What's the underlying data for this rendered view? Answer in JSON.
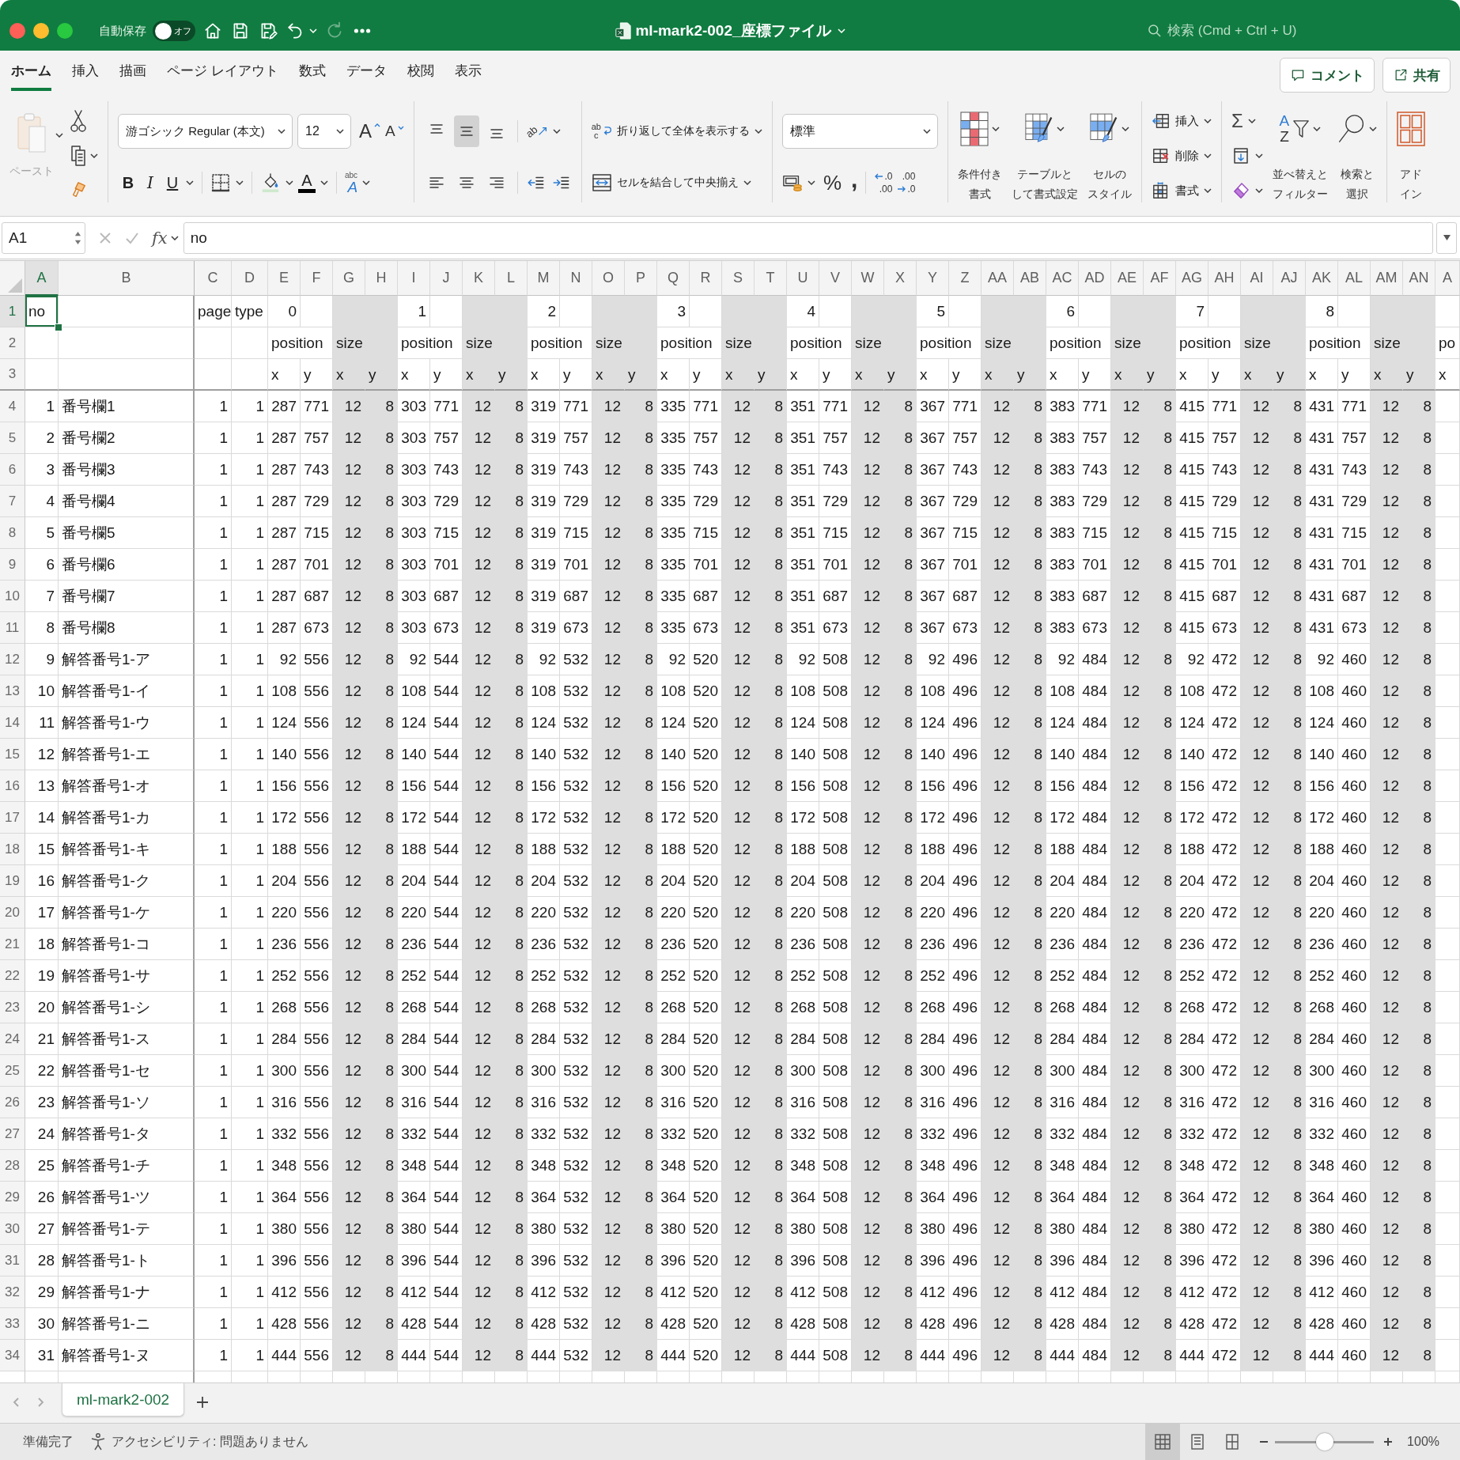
{
  "window": {
    "autosave": {
      "label": "自動保存",
      "on": false,
      "state": "オフ"
    },
    "redo": {
      "disabled": true
    },
    "title": "ml-mark2-002_座標ファイル",
    "search": {
      "placeholder": "検索 (Cmd + Ctrl + U)"
    }
  },
  "menu_tabs": [
    {
      "label": "ホーム",
      "selected": true
    },
    {
      "label": "挿入",
      "selected": false
    },
    {
      "label": "描画",
      "selected": false
    },
    {
      "label": "ページ レイアウト",
      "selected": false
    },
    {
      "label": "数式",
      "selected": false
    },
    {
      "label": "データ",
      "selected": false
    },
    {
      "label": "校閲",
      "selected": false
    },
    {
      "label": "表示",
      "selected": false
    }
  ],
  "header_buttons": [
    {
      "kind": "comment",
      "label": "コメント"
    },
    {
      "kind": "share",
      "label": "共有"
    }
  ],
  "ribbon": {
    "paste": {
      "label": "ペースト",
      "disabled": true
    },
    "font": {
      "name": "游ゴシック Regular (本文)",
      "size": "12",
      "grow": "A",
      "shrink": "A",
      "bold": "B",
      "italic": "I",
      "underline": "U",
      "color_letter": "A",
      "phonetic": [
        "abc",
        "A"
      ]
    },
    "alignment": {
      "vertical": [
        {
          "kind": "top",
          "selected": false
        },
        {
          "kind": "middle",
          "selected": true
        },
        {
          "kind": "bottom",
          "selected": false
        }
      ],
      "orientation": "ab",
      "horizontal": [
        {
          "kind": "left",
          "selected": false
        },
        {
          "kind": "center",
          "selected": false
        },
        {
          "kind": "right",
          "selected": false
        }
      ]
    },
    "wrap": {
      "icon_text": [
        "ab",
        "c"
      ],
      "label": "折り返して全体を表示する"
    },
    "merge": {
      "label": "セルを結合して中央揃え"
    },
    "number": {
      "format": "標準",
      "percent": "%",
      "comma": ",",
      "decimals": [
        {
          "kind": "increase",
          "top": ".0",
          "bottom": ".00"
        },
        {
          "kind": "decrease",
          "top": ".00",
          "bottom": ".0"
        }
      ]
    },
    "styles": [
      {
        "kind": "conditional",
        "lines": [
          "条件付き",
          "書式"
        ]
      },
      {
        "kind": "table",
        "lines": [
          "テーブルと",
          "して書式設定"
        ]
      },
      {
        "kind": "cell",
        "lines": [
          "セルの",
          "スタイル"
        ]
      }
    ],
    "cells": [
      {
        "kind": "insert",
        "label": "挿入"
      },
      {
        "kind": "delete",
        "label": "削除"
      },
      {
        "kind": "format",
        "label": "書式"
      }
    ],
    "editing": {
      "sum": "Σ",
      "sort": {
        "letters": [
          "A",
          "Z"
        ],
        "lines": [
          "並べ替えと",
          "フィルター"
        ]
      },
      "find": {
        "lines": [
          "検索と",
          "選択"
        ]
      }
    },
    "addins": {
      "lines": [
        "アド",
        "イン"
      ]
    }
  },
  "formula_bar": {
    "name_box": "A1",
    "cancel": {
      "disabled": true
    },
    "enter": {
      "disabled": true
    },
    "function_label": "fx",
    "formula": "no"
  },
  "sheet": {
    "frozen_columns": [
      {
        "label": "A",
        "selected": true,
        "shaded": false,
        "numeric": true
      },
      {
        "label": "B",
        "selected": false,
        "shaded": false,
        "numeric": false
      }
    ],
    "columns": [
      {
        "label": "C",
        "selected": false,
        "shaded": false,
        "numeric": true
      },
      {
        "label": "D",
        "selected": false,
        "shaded": false,
        "numeric": true
      },
      {
        "label": "E",
        "selected": false,
        "shaded": false,
        "numeric": true
      },
      {
        "label": "F",
        "selected": false,
        "shaded": false,
        "numeric": true
      },
      {
        "label": "G",
        "selected": false,
        "shaded": true,
        "numeric": true
      },
      {
        "label": "H",
        "selected": false,
        "shaded": true,
        "numeric": true
      },
      {
        "label": "I",
        "selected": false,
        "shaded": false,
        "numeric": true
      },
      {
        "label": "J",
        "selected": false,
        "shaded": false,
        "numeric": true
      },
      {
        "label": "K",
        "selected": false,
        "shaded": true,
        "numeric": true
      },
      {
        "label": "L",
        "selected": false,
        "shaded": true,
        "numeric": true
      },
      {
        "label": "M",
        "selected": false,
        "shaded": false,
        "numeric": true
      },
      {
        "label": "N",
        "selected": false,
        "shaded": false,
        "numeric": true
      },
      {
        "label": "O",
        "selected": false,
        "shaded": true,
        "numeric": true
      },
      {
        "label": "P",
        "selected": false,
        "shaded": true,
        "numeric": true
      },
      {
        "label": "Q",
        "selected": false,
        "shaded": false,
        "numeric": true
      },
      {
        "label": "R",
        "selected": false,
        "shaded": false,
        "numeric": true
      },
      {
        "label": "S",
        "selected": false,
        "shaded": true,
        "numeric": true
      },
      {
        "label": "T",
        "selected": false,
        "shaded": true,
        "numeric": true
      },
      {
        "label": "U",
        "selected": false,
        "shaded": false,
        "numeric": true
      },
      {
        "label": "V",
        "selected": false,
        "shaded": false,
        "numeric": true
      },
      {
        "label": "W",
        "selected": false,
        "shaded": true,
        "numeric": true
      },
      {
        "label": "X",
        "selected": false,
        "shaded": true,
        "numeric": true
      },
      {
        "label": "Y",
        "selected": false,
        "shaded": false,
        "numeric": true
      },
      {
        "label": "Z",
        "selected": false,
        "shaded": false,
        "numeric": true
      },
      {
        "label": "AA",
        "selected": false,
        "shaded": true,
        "numeric": true
      },
      {
        "label": "AB",
        "selected": false,
        "shaded": true,
        "numeric": true
      },
      {
        "label": "AC",
        "selected": false,
        "shaded": false,
        "numeric": true
      },
      {
        "label": "AD",
        "selected": false,
        "shaded": false,
        "numeric": true
      },
      {
        "label": "AE",
        "selected": false,
        "shaded": true,
        "numeric": true
      },
      {
        "label": "AF",
        "selected": false,
        "shaded": true,
        "numeric": true
      },
      {
        "label": "AG",
        "selected": false,
        "shaded": false,
        "numeric": true
      },
      {
        "label": "AH",
        "selected": false,
        "shaded": false,
        "numeric": true
      },
      {
        "label": "AI",
        "selected": false,
        "shaded": true,
        "numeric": true
      },
      {
        "label": "AJ",
        "selected": false,
        "shaded": true,
        "numeric": true
      },
      {
        "label": "AK",
        "selected": false,
        "shaded": false,
        "numeric": true
      },
      {
        "label": "AL",
        "selected": false,
        "shaded": false,
        "numeric": true
      },
      {
        "label": "AM",
        "selected": false,
        "shaded": true,
        "numeric": true
      },
      {
        "label": "AN",
        "selected": false,
        "shaded": true,
        "numeric": true
      },
      {
        "label": "A",
        "selected": false,
        "shaded": false
      }
    ],
    "header_rows": [
      {
        "header": "1",
        "selected": true,
        "cells": [
          {
            "text": "no",
            "numeric": false
          },
          null,
          {
            "text": "page",
            "numeric": false
          },
          {
            "text": "type",
            "numeric": false
          },
          {
            "text": "0",
            "numeric": true
          },
          null,
          null,
          null,
          {
            "text": "1",
            "numeric": true
          },
          null,
          null,
          null,
          {
            "text": "2",
            "numeric": true
          },
          null,
          null,
          null,
          {
            "text": "3",
            "numeric": true
          },
          null,
          null,
          null,
          {
            "text": "4",
            "numeric": true
          },
          null,
          null,
          null,
          {
            "text": "5",
            "numeric": true
          },
          null,
          null,
          null,
          {
            "text": "6",
            "numeric": true
          },
          null,
          null,
          null,
          {
            "text": "7",
            "numeric": true
          },
          null,
          null,
          null,
          {
            "text": "8",
            "numeric": true
          }
        ]
      },
      {
        "header": "2",
        "selected": false,
        "cells": [
          null,
          null,
          null,
          null,
          {
            "text": "position",
            "numeric": false
          },
          null,
          {
            "text": "size",
            "numeric": false
          },
          null,
          {
            "text": "position",
            "numeric": false
          },
          null,
          {
            "text": "size",
            "numeric": false
          },
          null,
          {
            "text": "position",
            "numeric": false
          },
          null,
          {
            "text": "size",
            "numeric": false
          },
          null,
          {
            "text": "position",
            "numeric": false
          },
          null,
          {
            "text": "size",
            "numeric": false
          },
          null,
          {
            "text": "position",
            "numeric": false
          },
          null,
          {
            "text": "size",
            "numeric": false
          },
          null,
          {
            "text": "position",
            "numeric": false
          },
          null,
          {
            "text": "size",
            "numeric": false
          },
          null,
          {
            "text": "position",
            "numeric": false
          },
          null,
          {
            "text": "size",
            "numeric": false
          },
          null,
          {
            "text": "position",
            "numeric": false
          },
          null,
          {
            "text": "size",
            "numeric": false
          },
          null,
          {
            "text": "position",
            "numeric": false
          },
          null,
          {
            "text": "size",
            "numeric": false
          },
          null,
          {
            "text": "po",
            "numeric": false
          }
        ]
      },
      {
        "header": "3",
        "selected": false,
        "cells": [
          null,
          null,
          null,
          null,
          {
            "text": "x",
            "numeric": false
          },
          {
            "text": "y",
            "numeric": false
          },
          {
            "text": "x",
            "numeric": false
          },
          {
            "text": "y",
            "numeric": false
          },
          {
            "text": "x",
            "numeric": false
          },
          {
            "text": "y",
            "numeric": false
          },
          {
            "text": "x",
            "numeric": false
          },
          {
            "text": "y",
            "numeric": false
          },
          {
            "text": "x",
            "numeric": false
          },
          {
            "text": "y",
            "numeric": false
          },
          {
            "text": "x",
            "numeric": false
          },
          {
            "text": "y",
            "numeric": false
          },
          {
            "text": "x",
            "numeric": false
          },
          {
            "text": "y",
            "numeric": false
          },
          {
            "text": "x",
            "numeric": false
          },
          {
            "text": "y",
            "numeric": false
          },
          {
            "text": "x",
            "numeric": false
          },
          {
            "text": "y",
            "numeric": false
          },
          {
            "text": "x",
            "numeric": false
          },
          {
            "text": "y",
            "numeric": false
          },
          {
            "text": "x",
            "numeric": false
          },
          {
            "text": "y",
            "numeric": false
          },
          {
            "text": "x",
            "numeric": false
          },
          {
            "text": "y",
            "numeric": false
          },
          {
            "text": "x",
            "numeric": false
          },
          {
            "text": "y",
            "numeric": false
          },
          {
            "text": "x",
            "numeric": false
          },
          {
            "text": "y",
            "numeric": false
          },
          {
            "text": "x",
            "numeric": false
          },
          {
            "text": "y",
            "numeric": false
          },
          {
            "text": "x",
            "numeric": false
          },
          {
            "text": "y",
            "numeric": false
          },
          {
            "text": "x",
            "numeric": false
          },
          {
            "text": "y",
            "numeric": false
          },
          {
            "text": "x",
            "numeric": false
          },
          {
            "text": "y",
            "numeric": false
          },
          {
            "text": "x",
            "numeric": false
          }
        ]
      }
    ],
    "data_rows": [
      {
        "header": "4",
        "selected": false,
        "cells": [
          "1",
          "番号欄1",
          "1",
          "1",
          "287",
          "771",
          "12",
          "8",
          "303",
          "771",
          "12",
          "8",
          "319",
          "771",
          "12",
          "8",
          "335",
          "771",
          "12",
          "8",
          "351",
          "771",
          "12",
          "8",
          "367",
          "771",
          "12",
          "8",
          "383",
          "771",
          "12",
          "8",
          "415",
          "771",
          "12",
          "8",
          "431",
          "771",
          "12",
          "8"
        ]
      },
      {
        "header": "5",
        "selected": false,
        "cells": [
          "2",
          "番号欄2",
          "1",
          "1",
          "287",
          "757",
          "12",
          "8",
          "303",
          "757",
          "12",
          "8",
          "319",
          "757",
          "12",
          "8",
          "335",
          "757",
          "12",
          "8",
          "351",
          "757",
          "12",
          "8",
          "367",
          "757",
          "12",
          "8",
          "383",
          "757",
          "12",
          "8",
          "415",
          "757",
          "12",
          "8",
          "431",
          "757",
          "12",
          "8"
        ]
      },
      {
        "header": "6",
        "selected": false,
        "cells": [
          "3",
          "番号欄3",
          "1",
          "1",
          "287",
          "743",
          "12",
          "8",
          "303",
          "743",
          "12",
          "8",
          "319",
          "743",
          "12",
          "8",
          "335",
          "743",
          "12",
          "8",
          "351",
          "743",
          "12",
          "8",
          "367",
          "743",
          "12",
          "8",
          "383",
          "743",
          "12",
          "8",
          "415",
          "743",
          "12",
          "8",
          "431",
          "743",
          "12",
          "8"
        ]
      },
      {
        "header": "7",
        "selected": false,
        "cells": [
          "4",
          "番号欄4",
          "1",
          "1",
          "287",
          "729",
          "12",
          "8",
          "303",
          "729",
          "12",
          "8",
          "319",
          "729",
          "12",
          "8",
          "335",
          "729",
          "12",
          "8",
          "351",
          "729",
          "12",
          "8",
          "367",
          "729",
          "12",
          "8",
          "383",
          "729",
          "12",
          "8",
          "415",
          "729",
          "12",
          "8",
          "431",
          "729",
          "12",
          "8"
        ]
      },
      {
        "header": "8",
        "selected": false,
        "cells": [
          "5",
          "番号欄5",
          "1",
          "1",
          "287",
          "715",
          "12",
          "8",
          "303",
          "715",
          "12",
          "8",
          "319",
          "715",
          "12",
          "8",
          "335",
          "715",
          "12",
          "8",
          "351",
          "715",
          "12",
          "8",
          "367",
          "715",
          "12",
          "8",
          "383",
          "715",
          "12",
          "8",
          "415",
          "715",
          "12",
          "8",
          "431",
          "715",
          "12",
          "8"
        ]
      },
      {
        "header": "9",
        "selected": false,
        "cells": [
          "6",
          "番号欄6",
          "1",
          "1",
          "287",
          "701",
          "12",
          "8",
          "303",
          "701",
          "12",
          "8",
          "319",
          "701",
          "12",
          "8",
          "335",
          "701",
          "12",
          "8",
          "351",
          "701",
          "12",
          "8",
          "367",
          "701",
          "12",
          "8",
          "383",
          "701",
          "12",
          "8",
          "415",
          "701",
          "12",
          "8",
          "431",
          "701",
          "12",
          "8"
        ]
      },
      {
        "header": "10",
        "selected": false,
        "cells": [
          "7",
          "番号欄7",
          "1",
          "1",
          "287",
          "687",
          "12",
          "8",
          "303",
          "687",
          "12",
          "8",
          "319",
          "687",
          "12",
          "8",
          "335",
          "687",
          "12",
          "8",
          "351",
          "687",
          "12",
          "8",
          "367",
          "687",
          "12",
          "8",
          "383",
          "687",
          "12",
          "8",
          "415",
          "687",
          "12",
          "8",
          "431",
          "687",
          "12",
          "8"
        ]
      },
      {
        "header": "11",
        "selected": false,
        "cells": [
          "8",
          "番号欄8",
          "1",
          "1",
          "287",
          "673",
          "12",
          "8",
          "303",
          "673",
          "12",
          "8",
          "319",
          "673",
          "12",
          "8",
          "335",
          "673",
          "12",
          "8",
          "351",
          "673",
          "12",
          "8",
          "367",
          "673",
          "12",
          "8",
          "383",
          "673",
          "12",
          "8",
          "415",
          "673",
          "12",
          "8",
          "431",
          "673",
          "12",
          "8"
        ]
      },
      {
        "header": "12",
        "selected": false,
        "cells": [
          "9",
          "解答番号1-ア",
          "1",
          "1",
          "92",
          "556",
          "12",
          "8",
          "92",
          "544",
          "12",
          "8",
          "92",
          "532",
          "12",
          "8",
          "92",
          "520",
          "12",
          "8",
          "92",
          "508",
          "12",
          "8",
          "92",
          "496",
          "12",
          "8",
          "92",
          "484",
          "12",
          "8",
          "92",
          "472",
          "12",
          "8",
          "92",
          "460",
          "12",
          "8"
        ]
      },
      {
        "header": "13",
        "selected": false,
        "cells": [
          "10",
          "解答番号1-イ",
          "1",
          "1",
          "108",
          "556",
          "12",
          "8",
          "108",
          "544",
          "12",
          "8",
          "108",
          "532",
          "12",
          "8",
          "108",
          "520",
          "12",
          "8",
          "108",
          "508",
          "12",
          "8",
          "108",
          "496",
          "12",
          "8",
          "108",
          "484",
          "12",
          "8",
          "108",
          "472",
          "12",
          "8",
          "108",
          "460",
          "12",
          "8"
        ]
      },
      {
        "header": "14",
        "selected": false,
        "cells": [
          "11",
          "解答番号1-ウ",
          "1",
          "1",
          "124",
          "556",
          "12",
          "8",
          "124",
          "544",
          "12",
          "8",
          "124",
          "532",
          "12",
          "8",
          "124",
          "520",
          "12",
          "8",
          "124",
          "508",
          "12",
          "8",
          "124",
          "496",
          "12",
          "8",
          "124",
          "484",
          "12",
          "8",
          "124",
          "472",
          "12",
          "8",
          "124",
          "460",
          "12",
          "8"
        ]
      },
      {
        "header": "15",
        "selected": false,
        "cells": [
          "12",
          "解答番号1-エ",
          "1",
          "1",
          "140",
          "556",
          "12",
          "8",
          "140",
          "544",
          "12",
          "8",
          "140",
          "532",
          "12",
          "8",
          "140",
          "520",
          "12",
          "8",
          "140",
          "508",
          "12",
          "8",
          "140",
          "496",
          "12",
          "8",
          "140",
          "484",
          "12",
          "8",
          "140",
          "472",
          "12",
          "8",
          "140",
          "460",
          "12",
          "8"
        ]
      },
      {
        "header": "16",
        "selected": false,
        "cells": [
          "13",
          "解答番号1-オ",
          "1",
          "1",
          "156",
          "556",
          "12",
          "8",
          "156",
          "544",
          "12",
          "8",
          "156",
          "532",
          "12",
          "8",
          "156",
          "520",
          "12",
          "8",
          "156",
          "508",
          "12",
          "8",
          "156",
          "496",
          "12",
          "8",
          "156",
          "484",
          "12",
          "8",
          "156",
          "472",
          "12",
          "8",
          "156",
          "460",
          "12",
          "8"
        ]
      },
      {
        "header": "17",
        "selected": false,
        "cells": [
          "14",
          "解答番号1-カ",
          "1",
          "1",
          "172",
          "556",
          "12",
          "8",
          "172",
          "544",
          "12",
          "8",
          "172",
          "532",
          "12",
          "8",
          "172",
          "520",
          "12",
          "8",
          "172",
          "508",
          "12",
          "8",
          "172",
          "496",
          "12",
          "8",
          "172",
          "484",
          "12",
          "8",
          "172",
          "472",
          "12",
          "8",
          "172",
          "460",
          "12",
          "8"
        ]
      },
      {
        "header": "18",
        "selected": false,
        "cells": [
          "15",
          "解答番号1-キ",
          "1",
          "1",
          "188",
          "556",
          "12",
          "8",
          "188",
          "544",
          "12",
          "8",
          "188",
          "532",
          "12",
          "8",
          "188",
          "520",
          "12",
          "8",
          "188",
          "508",
          "12",
          "8",
          "188",
          "496",
          "12",
          "8",
          "188",
          "484",
          "12",
          "8",
          "188",
          "472",
          "12",
          "8",
          "188",
          "460",
          "12",
          "8"
        ]
      },
      {
        "header": "19",
        "selected": false,
        "cells": [
          "16",
          "解答番号1-ク",
          "1",
          "1",
          "204",
          "556",
          "12",
          "8",
          "204",
          "544",
          "12",
          "8",
          "204",
          "532",
          "12",
          "8",
          "204",
          "520",
          "12",
          "8",
          "204",
          "508",
          "12",
          "8",
          "204",
          "496",
          "12",
          "8",
          "204",
          "484",
          "12",
          "8",
          "204",
          "472",
          "12",
          "8",
          "204",
          "460",
          "12",
          "8"
        ]
      },
      {
        "header": "20",
        "selected": false,
        "cells": [
          "17",
          "解答番号1-ケ",
          "1",
          "1",
          "220",
          "556",
          "12",
          "8",
          "220",
          "544",
          "12",
          "8",
          "220",
          "532",
          "12",
          "8",
          "220",
          "520",
          "12",
          "8",
          "220",
          "508",
          "12",
          "8",
          "220",
          "496",
          "12",
          "8",
          "220",
          "484",
          "12",
          "8",
          "220",
          "472",
          "12",
          "8",
          "220",
          "460",
          "12",
          "8"
        ]
      },
      {
        "header": "21",
        "selected": false,
        "cells": [
          "18",
          "解答番号1-コ",
          "1",
          "1",
          "236",
          "556",
          "12",
          "8",
          "236",
          "544",
          "12",
          "8",
          "236",
          "532",
          "12",
          "8",
          "236",
          "520",
          "12",
          "8",
          "236",
          "508",
          "12",
          "8",
          "236",
          "496",
          "12",
          "8",
          "236",
          "484",
          "12",
          "8",
          "236",
          "472",
          "12",
          "8",
          "236",
          "460",
          "12",
          "8"
        ]
      },
      {
        "header": "22",
        "selected": false,
        "cells": [
          "19",
          "解答番号1-サ",
          "1",
          "1",
          "252",
          "556",
          "12",
          "8",
          "252",
          "544",
          "12",
          "8",
          "252",
          "532",
          "12",
          "8",
          "252",
          "520",
          "12",
          "8",
          "252",
          "508",
          "12",
          "8",
          "252",
          "496",
          "12",
          "8",
          "252",
          "484",
          "12",
          "8",
          "252",
          "472",
          "12",
          "8",
          "252",
          "460",
          "12",
          "8"
        ]
      },
      {
        "header": "23",
        "selected": false,
        "cells": [
          "20",
          "解答番号1-シ",
          "1",
          "1",
          "268",
          "556",
          "12",
          "8",
          "268",
          "544",
          "12",
          "8",
          "268",
          "532",
          "12",
          "8",
          "268",
          "520",
          "12",
          "8",
          "268",
          "508",
          "12",
          "8",
          "268",
          "496",
          "12",
          "8",
          "268",
          "484",
          "12",
          "8",
          "268",
          "472",
          "12",
          "8",
          "268",
          "460",
          "12",
          "8"
        ]
      },
      {
        "header": "24",
        "selected": false,
        "cells": [
          "21",
          "解答番号1-ス",
          "1",
          "1",
          "284",
          "556",
          "12",
          "8",
          "284",
          "544",
          "12",
          "8",
          "284",
          "532",
          "12",
          "8",
          "284",
          "520",
          "12",
          "8",
          "284",
          "508",
          "12",
          "8",
          "284",
          "496",
          "12",
          "8",
          "284",
          "484",
          "12",
          "8",
          "284",
          "472",
          "12",
          "8",
          "284",
          "460",
          "12",
          "8"
        ]
      },
      {
        "header": "25",
        "selected": false,
        "cells": [
          "22",
          "解答番号1-セ",
          "1",
          "1",
          "300",
          "556",
          "12",
          "8",
          "300",
          "544",
          "12",
          "8",
          "300",
          "532",
          "12",
          "8",
          "300",
          "520",
          "12",
          "8",
          "300",
          "508",
          "12",
          "8",
          "300",
          "496",
          "12",
          "8",
          "300",
          "484",
          "12",
          "8",
          "300",
          "472",
          "12",
          "8",
          "300",
          "460",
          "12",
          "8"
        ]
      },
      {
        "header": "26",
        "selected": false,
        "cells": [
          "23",
          "解答番号1-ソ",
          "1",
          "1",
          "316",
          "556",
          "12",
          "8",
          "316",
          "544",
          "12",
          "8",
          "316",
          "532",
          "12",
          "8",
          "316",
          "520",
          "12",
          "8",
          "316",
          "508",
          "12",
          "8",
          "316",
          "496",
          "12",
          "8",
          "316",
          "484",
          "12",
          "8",
          "316",
          "472",
          "12",
          "8",
          "316",
          "460",
          "12",
          "8"
        ]
      },
      {
        "header": "27",
        "selected": false,
        "cells": [
          "24",
          "解答番号1-タ",
          "1",
          "1",
          "332",
          "556",
          "12",
          "8",
          "332",
          "544",
          "12",
          "8",
          "332",
          "532",
          "12",
          "8",
          "332",
          "520",
          "12",
          "8",
          "332",
          "508",
          "12",
          "8",
          "332",
          "496",
          "12",
          "8",
          "332",
          "484",
          "12",
          "8",
          "332",
          "472",
          "12",
          "8",
          "332",
          "460",
          "12",
          "8"
        ]
      },
      {
        "header": "28",
        "selected": false,
        "cells": [
          "25",
          "解答番号1-チ",
          "1",
          "1",
          "348",
          "556",
          "12",
          "8",
          "348",
          "544",
          "12",
          "8",
          "348",
          "532",
          "12",
          "8",
          "348",
          "520",
          "12",
          "8",
          "348",
          "508",
          "12",
          "8",
          "348",
          "496",
          "12",
          "8",
          "348",
          "484",
          "12",
          "8",
          "348",
          "472",
          "12",
          "8",
          "348",
          "460",
          "12",
          "8"
        ]
      },
      {
        "header": "29",
        "selected": false,
        "cells": [
          "26",
          "解答番号1-ツ",
          "1",
          "1",
          "364",
          "556",
          "12",
          "8",
          "364",
          "544",
          "12",
          "8",
          "364",
          "532",
          "12",
          "8",
          "364",
          "520",
          "12",
          "8",
          "364",
          "508",
          "12",
          "8",
          "364",
          "496",
          "12",
          "8",
          "364",
          "484",
          "12",
          "8",
          "364",
          "472",
          "12",
          "8",
          "364",
          "460",
          "12",
          "8"
        ]
      },
      {
        "header": "30",
        "selected": false,
        "cells": [
          "27",
          "解答番号1-テ",
          "1",
          "1",
          "380",
          "556",
          "12",
          "8",
          "380",
          "544",
          "12",
          "8",
          "380",
          "532",
          "12",
          "8",
          "380",
          "520",
          "12",
          "8",
          "380",
          "508",
          "12",
          "8",
          "380",
          "496",
          "12",
          "8",
          "380",
          "484",
          "12",
          "8",
          "380",
          "472",
          "12",
          "8",
          "380",
          "460",
          "12",
          "8"
        ]
      },
      {
        "header": "31",
        "selected": false,
        "cells": [
          "28",
          "解答番号1-ト",
          "1",
          "1",
          "396",
          "556",
          "12",
          "8",
          "396",
          "544",
          "12",
          "8",
          "396",
          "532",
          "12",
          "8",
          "396",
          "520",
          "12",
          "8",
          "396",
          "508",
          "12",
          "8",
          "396",
          "496",
          "12",
          "8",
          "396",
          "484",
          "12",
          "8",
          "396",
          "472",
          "12",
          "8",
          "396",
          "460",
          "12",
          "8"
        ]
      },
      {
        "header": "32",
        "selected": false,
        "cells": [
          "29",
          "解答番号1-ナ",
          "1",
          "1",
          "412",
          "556",
          "12",
          "8",
          "412",
          "544",
          "12",
          "8",
          "412",
          "532",
          "12",
          "8",
          "412",
          "520",
          "12",
          "8",
          "412",
          "508",
          "12",
          "8",
          "412",
          "496",
          "12",
          "8",
          "412",
          "484",
          "12",
          "8",
          "412",
          "472",
          "12",
          "8",
          "412",
          "460",
          "12",
          "8"
        ]
      },
      {
        "header": "33",
        "selected": false,
        "cells": [
          "30",
          "解答番号1-ニ",
          "1",
          "1",
          "428",
          "556",
          "12",
          "8",
          "428",
          "544",
          "12",
          "8",
          "428",
          "532",
          "12",
          "8",
          "428",
          "520",
          "12",
          "8",
          "428",
          "508",
          "12",
          "8",
          "428",
          "496",
          "12",
          "8",
          "428",
          "484",
          "12",
          "8",
          "428",
          "472",
          "12",
          "8",
          "428",
          "460",
          "12",
          "8"
        ]
      },
      {
        "header": "34",
        "selected": false,
        "cells": [
          "31",
          "解答番号1-ヌ",
          "1",
          "1",
          "444",
          "556",
          "12",
          "8",
          "444",
          "544",
          "12",
          "8",
          "444",
          "532",
          "12",
          "8",
          "444",
          "520",
          "12",
          "8",
          "444",
          "508",
          "12",
          "8",
          "444",
          "496",
          "12",
          "8",
          "444",
          "484",
          "12",
          "8",
          "444",
          "472",
          "12",
          "8",
          "444",
          "460",
          "12",
          "8"
        ]
      }
    ]
  },
  "sheet_tabs": [
    {
      "label": "ml-mark2-002",
      "selected": true
    }
  ],
  "status_bar": {
    "status": "準備完了",
    "accessibility": "アクセシビリティ: 問題ありません",
    "views": [
      {
        "kind": "normal",
        "selected": true
      },
      {
        "kind": "page_layout",
        "selected": false
      },
      {
        "kind": "page_break",
        "selected": false
      }
    ],
    "zoom": {
      "level": 0.5,
      "reading": "100%"
    }
  }
}
